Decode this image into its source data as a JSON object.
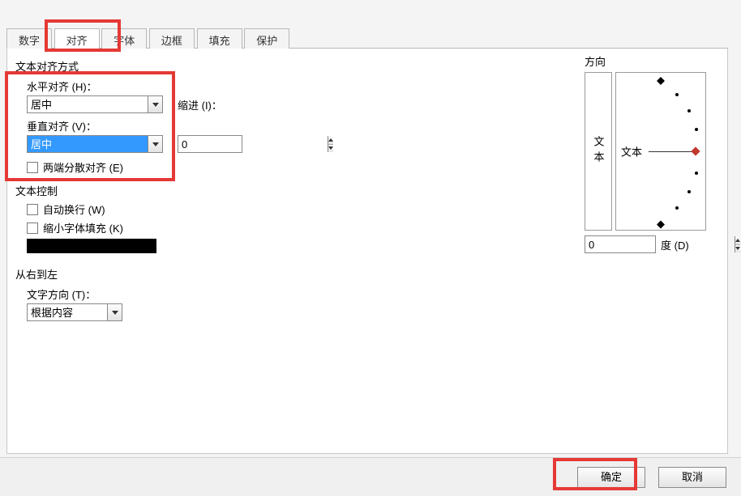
{
  "tabs": {
    "number": "数字",
    "align": "对齐",
    "font": "字体",
    "border": "边框",
    "fill": "填充",
    "protect": "保护"
  },
  "align_section": {
    "title": "文本对齐方式",
    "h_label": "水平对齐 (H)：",
    "h_value": "居中",
    "v_label": "垂直对齐 (V)：",
    "v_value": "居中",
    "indent_label": "缩进 (I)：",
    "indent_value": "0",
    "justify_distributed": "两端分散对齐 (E)"
  },
  "text_control": {
    "title": "文本控制",
    "wrap": "自动换行 (W)",
    "shrink": "缩小字体填充 (K)"
  },
  "rtl": {
    "title": "从右到左",
    "dir_label": "文字方向 (T)：",
    "dir_value": "根据内容"
  },
  "orientation": {
    "title": "方向",
    "vertical_label": "文本",
    "dial_label": "文本",
    "degree_value": "0",
    "degree_suffix": "度 (D)"
  },
  "buttons": {
    "ok": "确定",
    "cancel": "取消"
  }
}
